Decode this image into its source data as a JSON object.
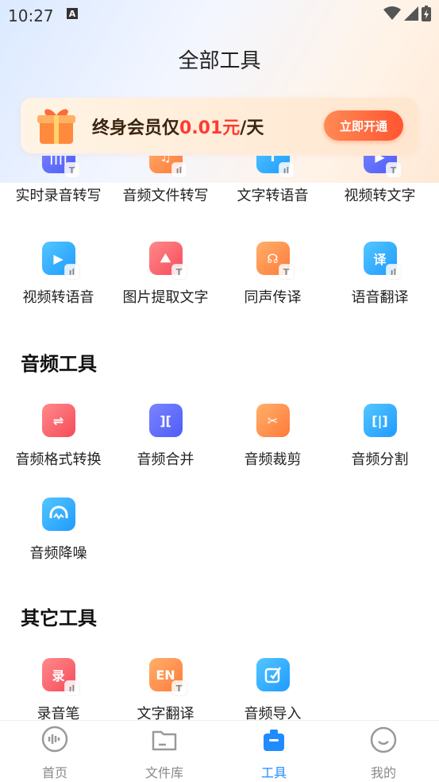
{
  "status_bar": {
    "time": "10:27",
    "notif_letter": "A"
  },
  "page": {
    "title": "全部工具"
  },
  "banner": {
    "prefix": "终身会员仅",
    "price": "0.01元",
    "suffix": "/天",
    "cta": "立即开通"
  },
  "sections": {
    "top": {
      "row1": [
        "实时录音转写",
        "音频文件转写",
        "文字转语音",
        "视频转文字"
      ],
      "row2": [
        "视频转语音",
        "图片提取文字",
        "同声传译",
        "语音翻译"
      ]
    },
    "audio": {
      "title": "音频工具",
      "row1": [
        "音频格式转换",
        "音频合并",
        "音频裁剪",
        "音频分割"
      ],
      "row2": [
        "音频降噪"
      ]
    },
    "other": {
      "title": "其它工具",
      "row1": [
        "录音笔",
        "文字翻译",
        "音频导入"
      ]
    }
  },
  "icon_glyphs": {
    "t": "T",
    "yi": "译",
    "lu": "录",
    "en": "EN",
    "swap": "⇌",
    "merge": "][",
    "cut": "✂",
    "split": "[|]"
  },
  "tabbar": {
    "items": [
      {
        "label": "首页",
        "icon": "waveform-icon"
      },
      {
        "label": "文件库",
        "icon": "folder-icon"
      },
      {
        "label": "工具",
        "icon": "briefcase-icon"
      },
      {
        "label": "我的",
        "icon": "smile-icon"
      }
    ],
    "active_index": 2
  },
  "colors": {
    "accent": "#1f8bff",
    "price": "#ff3b2f",
    "cta": "#ff5530"
  }
}
